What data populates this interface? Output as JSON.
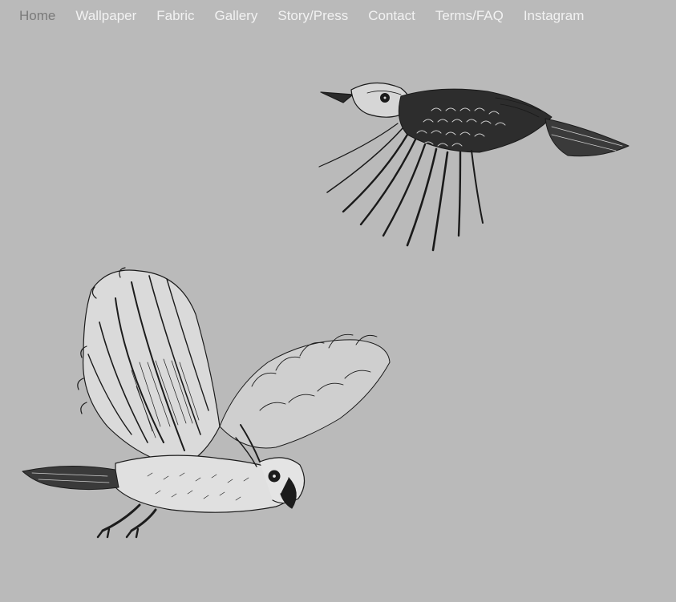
{
  "nav": {
    "items": [
      {
        "label": "Home",
        "active": true
      },
      {
        "label": "Wallpaper",
        "active": false
      },
      {
        "label": "Fabric",
        "active": false
      },
      {
        "label": "Gallery",
        "active": false
      },
      {
        "label": "Story/Press",
        "active": false
      },
      {
        "label": "Contact",
        "active": false
      },
      {
        "label": "Terms/FAQ",
        "active": false
      },
      {
        "label": "Instagram",
        "active": false
      }
    ]
  },
  "colors": {
    "background": "#bababa",
    "nav_text": "#f2f2f2",
    "nav_active": "#7a7a7a",
    "ink": "#1a1a1a"
  },
  "illustrations": [
    {
      "icon": "kookaburra-drawing"
    },
    {
      "icon": "cockatoo-drawing"
    }
  ]
}
